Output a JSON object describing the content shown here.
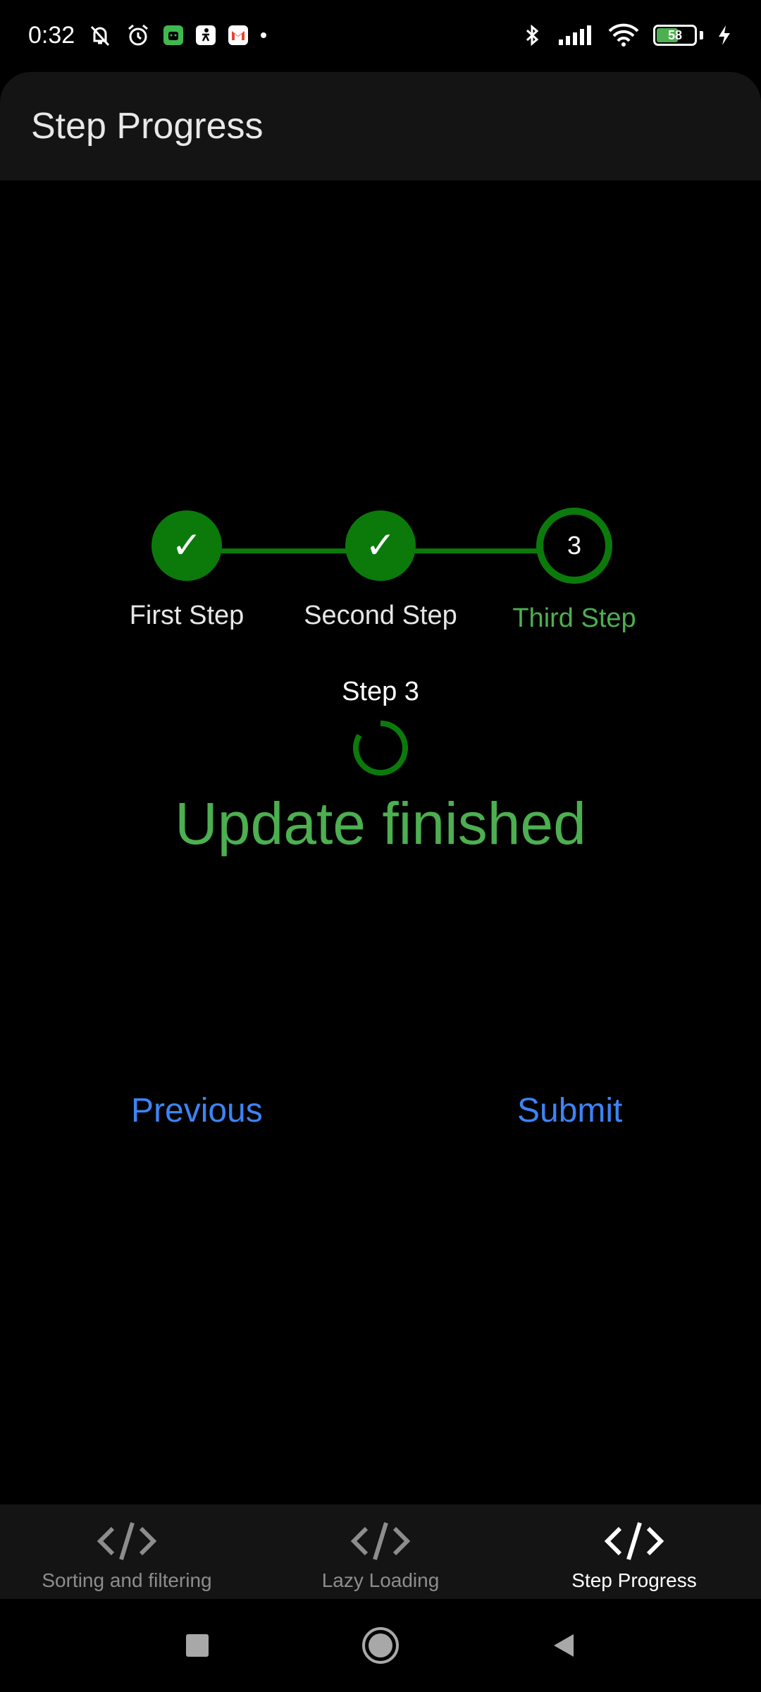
{
  "status_bar": {
    "time": "0:32",
    "battery": "58",
    "battery_level": 0.58,
    "icons": [
      "bell-muted-icon",
      "alarm-icon",
      "android-app-icon",
      "figure-app-icon",
      "gmail-icon",
      "dot-icon",
      "bluetooth-icon",
      "signal-icon",
      "wifi-icon",
      "battery-icon",
      "charging-icon"
    ]
  },
  "app_bar": {
    "title": "Step Progress"
  },
  "stepper": {
    "accent_color": "#0b7a0b",
    "active_label_color": "#4caf50",
    "steps": [
      {
        "label": "First Step",
        "state": "done",
        "marker": "✓"
      },
      {
        "label": "Second Step",
        "state": "done",
        "marker": "✓"
      },
      {
        "label": "Third Step",
        "state": "active",
        "marker": "3"
      }
    ]
  },
  "content": {
    "step_caption": "Step 3",
    "status_message": "Update finished"
  },
  "actions": {
    "previous_label": "Previous",
    "submit_label": "Submit",
    "color": "#3d84f5"
  },
  "bottom_nav": {
    "items": [
      {
        "label": "Sorting and filtering",
        "icon": "code-icon",
        "selected": false
      },
      {
        "label": "Lazy Loading",
        "icon": "code-icon",
        "selected": false
      },
      {
        "label": "Step Progress",
        "icon": "code-icon",
        "selected": true
      }
    ]
  },
  "system_nav": {
    "buttons": [
      "recents-square-icon",
      "home-circle-icon",
      "back-triangle-icon"
    ]
  }
}
